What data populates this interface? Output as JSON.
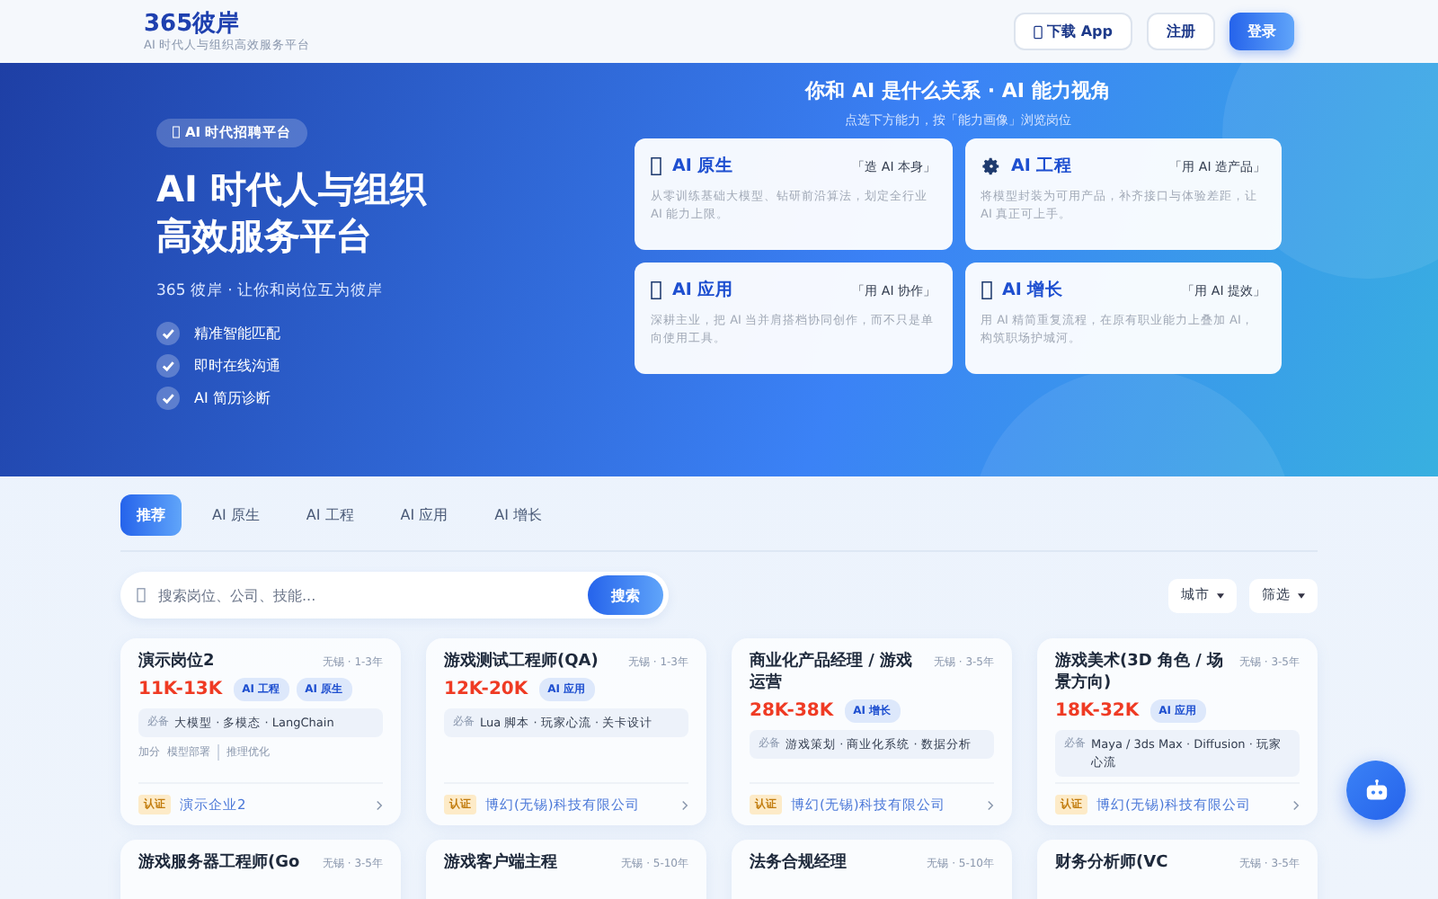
{
  "header": {
    "logo": "365彼岸",
    "tagline": "AI 时代人与组织高效服务平台",
    "buttons": [
      {
        "label": "下载 App",
        "kind": "download"
      },
      {
        "label": "注册",
        "kind": "secondary"
      },
      {
        "label": "登录",
        "kind": "primary"
      }
    ]
  },
  "hero": {
    "badge": "AI 时代招聘平台",
    "title_lines": [
      "AI 时代人与组织",
      "高效服务平台"
    ],
    "subtitle": "365 彼岸 · 让你和岗位互为彼岸",
    "features": [
      "精准智能匹配",
      "即时在线沟通",
      "AI 简历诊断"
    ],
    "panel": {
      "title": "你和 AI 是什么关系 · AI 能力视角",
      "subtitle": "点选下方能力，按「能力画像」浏览岗位",
      "cards": [
        {
          "kind": "box",
          "name": "AI 原生",
          "motto": "「造 AI 本身」",
          "desc": "从零训练基础大模型、钻研前沿算法，划定全行业 AI 能力上限。"
        },
        {
          "kind": "gear",
          "name": "AI 工程",
          "motto": "「用 AI 造产品」",
          "desc": "将模型封装为可用产品，补齐接口与体验差距，让 AI 真正可上手。"
        },
        {
          "kind": "box",
          "name": "AI 应用",
          "motto": "「用 AI 协作」",
          "desc": "深耕主业，把 AI 当并肩搭档协同创作，而不只是单向使用工具。"
        },
        {
          "kind": "box",
          "name": "AI 增长",
          "motto": "「用 AI 提效」",
          "desc": "用 AI 精简重复流程，在原有职业能力上叠加 AI，构筑职场护城河。"
        }
      ]
    }
  },
  "tabs": [
    {
      "label": "推荐",
      "selected": true
    },
    {
      "label": "AI 原生",
      "selected": false
    },
    {
      "label": "AI 工程",
      "selected": false
    },
    {
      "label": "AI 应用",
      "selected": false
    },
    {
      "label": "AI 增长",
      "selected": false
    }
  ],
  "search": {
    "placeholder": "搜索岗位、公司、技能...",
    "button": "搜索",
    "filters": [
      "城市",
      "筛选"
    ]
  },
  "jobs": [
    {
      "title": "演示岗位2",
      "meta": "无锡 · 1-3年",
      "salary": "11K-13K",
      "tags": [
        "AI 工程",
        "AI 原生"
      ],
      "required_label": "必备",
      "required": "大模型 · 多模态 · LangChain",
      "bonus_label": "加分",
      "bonus": [
        "模型部署",
        "推理优化"
      ],
      "cert": "认证",
      "company": "演示企业2"
    },
    {
      "title": "游戏测试工程师(QA)",
      "meta": "无锡 · 1-3年",
      "salary": "12K-20K",
      "tags": [
        "AI 应用"
      ],
      "required_label": "必备",
      "required": "Lua 脚本 · 玩家心流 · 关卡设计",
      "cert": "认证",
      "company": "博幻(无锡)科技有限公司"
    },
    {
      "title": "商业化产品经理 / 游戏运营",
      "meta": "无锡 · 3-5年",
      "salary": "28K-38K",
      "tags": [
        "AI 增长"
      ],
      "required_label": "必备",
      "required": "游戏策划 · 商业化系统 · 数据分析",
      "cert": "认证",
      "company": "博幻(无锡)科技有限公司"
    },
    {
      "title": "游戏美术(3D 角色 / 场景方向)",
      "meta": "无锡 · 3-5年",
      "salary": "18K-32K",
      "tags": [
        "AI 应用"
      ],
      "required_label": "必备",
      "required": "Maya / 3ds Max · Diffusion · 玩家心流",
      "cert": "认证",
      "company": "博幻(无锡)科技有限公司"
    },
    {
      "title": "游戏服务器工程师(Go",
      "meta": "无锡 · 3-5年"
    },
    {
      "title": "游戏客户端主程",
      "meta": "无锡 · 5-10年"
    },
    {
      "title": "法务合规经理",
      "meta": "无锡 · 5-10年"
    },
    {
      "title": "财务分析师(VC",
      "meta": "无锡 · 3-5年"
    }
  ]
}
